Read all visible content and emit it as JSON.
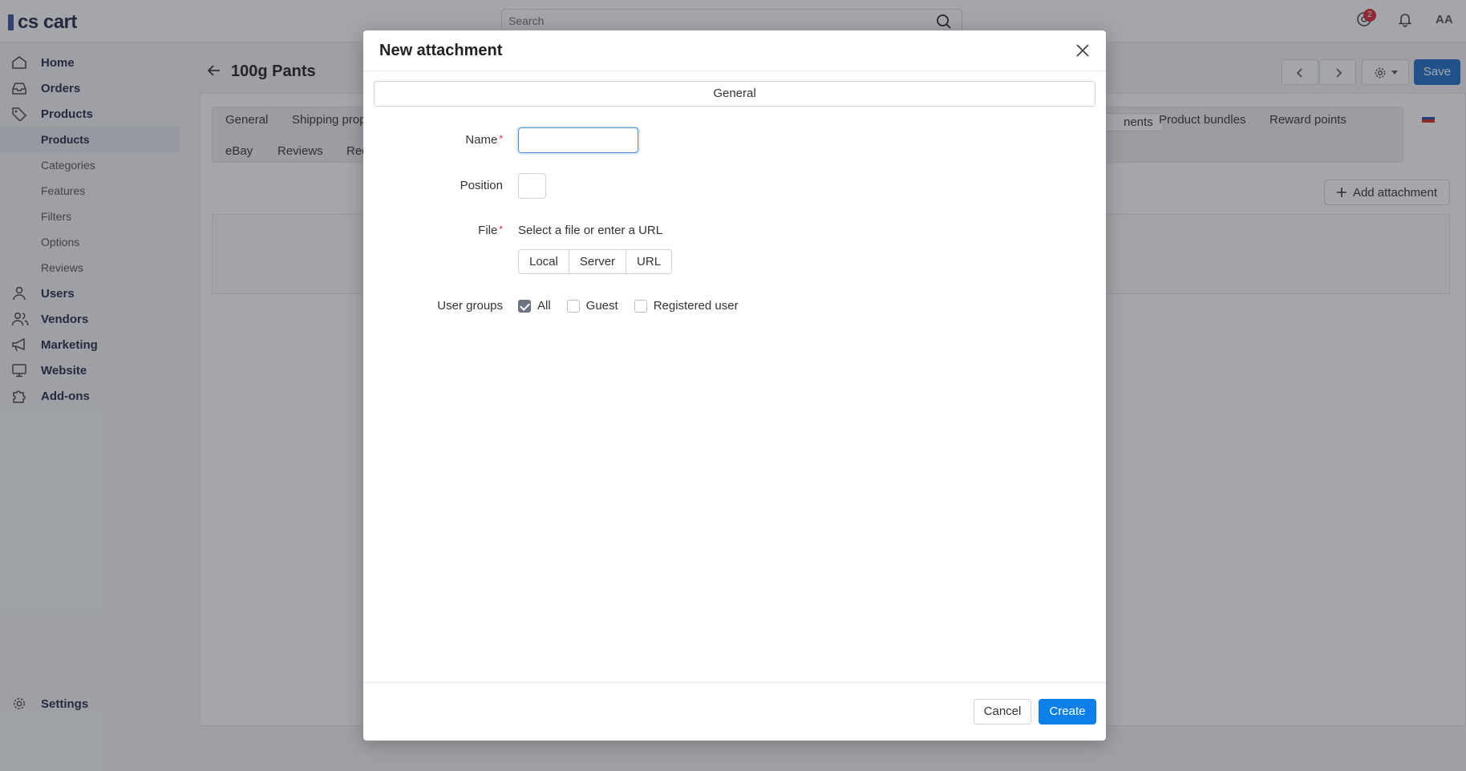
{
  "header": {
    "logo_text": "cs cart",
    "search_placeholder": "Search",
    "notifications_badge": "2",
    "avatar_initials": "AA"
  },
  "sidebar": {
    "items": [
      {
        "label": "Home",
        "icon": "home-icon"
      },
      {
        "label": "Orders",
        "icon": "inbox-icon"
      },
      {
        "label": "Products",
        "icon": "tag-icon"
      }
    ],
    "sub_items": [
      {
        "label": "Products",
        "active": true
      },
      {
        "label": "Categories"
      },
      {
        "label": "Features"
      },
      {
        "label": "Filters"
      },
      {
        "label": "Options"
      },
      {
        "label": "Reviews"
      }
    ],
    "items2": [
      {
        "label": "Users",
        "icon": "user-icon"
      },
      {
        "label": "Vendors",
        "icon": "users-icon"
      },
      {
        "label": "Marketing",
        "icon": "megaphone-icon"
      },
      {
        "label": "Website",
        "icon": "monitor-icon"
      },
      {
        "label": "Add-ons",
        "icon": "puzzle-icon"
      }
    ],
    "settings_label": "Settings"
  },
  "page": {
    "title": "100g Pants",
    "save_label": "Save",
    "add_attachment_label": "Add attachment",
    "tabs_row1": [
      "General",
      "Shipping prop",
      "nents",
      "Product bundles",
      "Reward points"
    ],
    "tabs_row2": [
      "eBay",
      "Reviews",
      "Rec"
    ]
  },
  "modal": {
    "title": "New attachment",
    "section_tab": "General",
    "fields": {
      "name_label": "Name",
      "name_value": "",
      "position_label": "Position",
      "position_value": "",
      "file_label": "File",
      "file_hint": "Select a file or enter a URL",
      "file_sources": [
        "Local",
        "Server",
        "URL"
      ],
      "user_groups_label": "User groups",
      "user_groups": [
        {
          "label": "All",
          "checked": true
        },
        {
          "label": "Guest",
          "checked": false
        },
        {
          "label": "Registered user",
          "checked": false
        }
      ]
    },
    "required_mark": "*",
    "cancel_label": "Cancel",
    "create_label": "Create"
  },
  "colors": {
    "primary": "#0d7fe8",
    "save": "#1a6fc7",
    "required": "#d9263a"
  }
}
